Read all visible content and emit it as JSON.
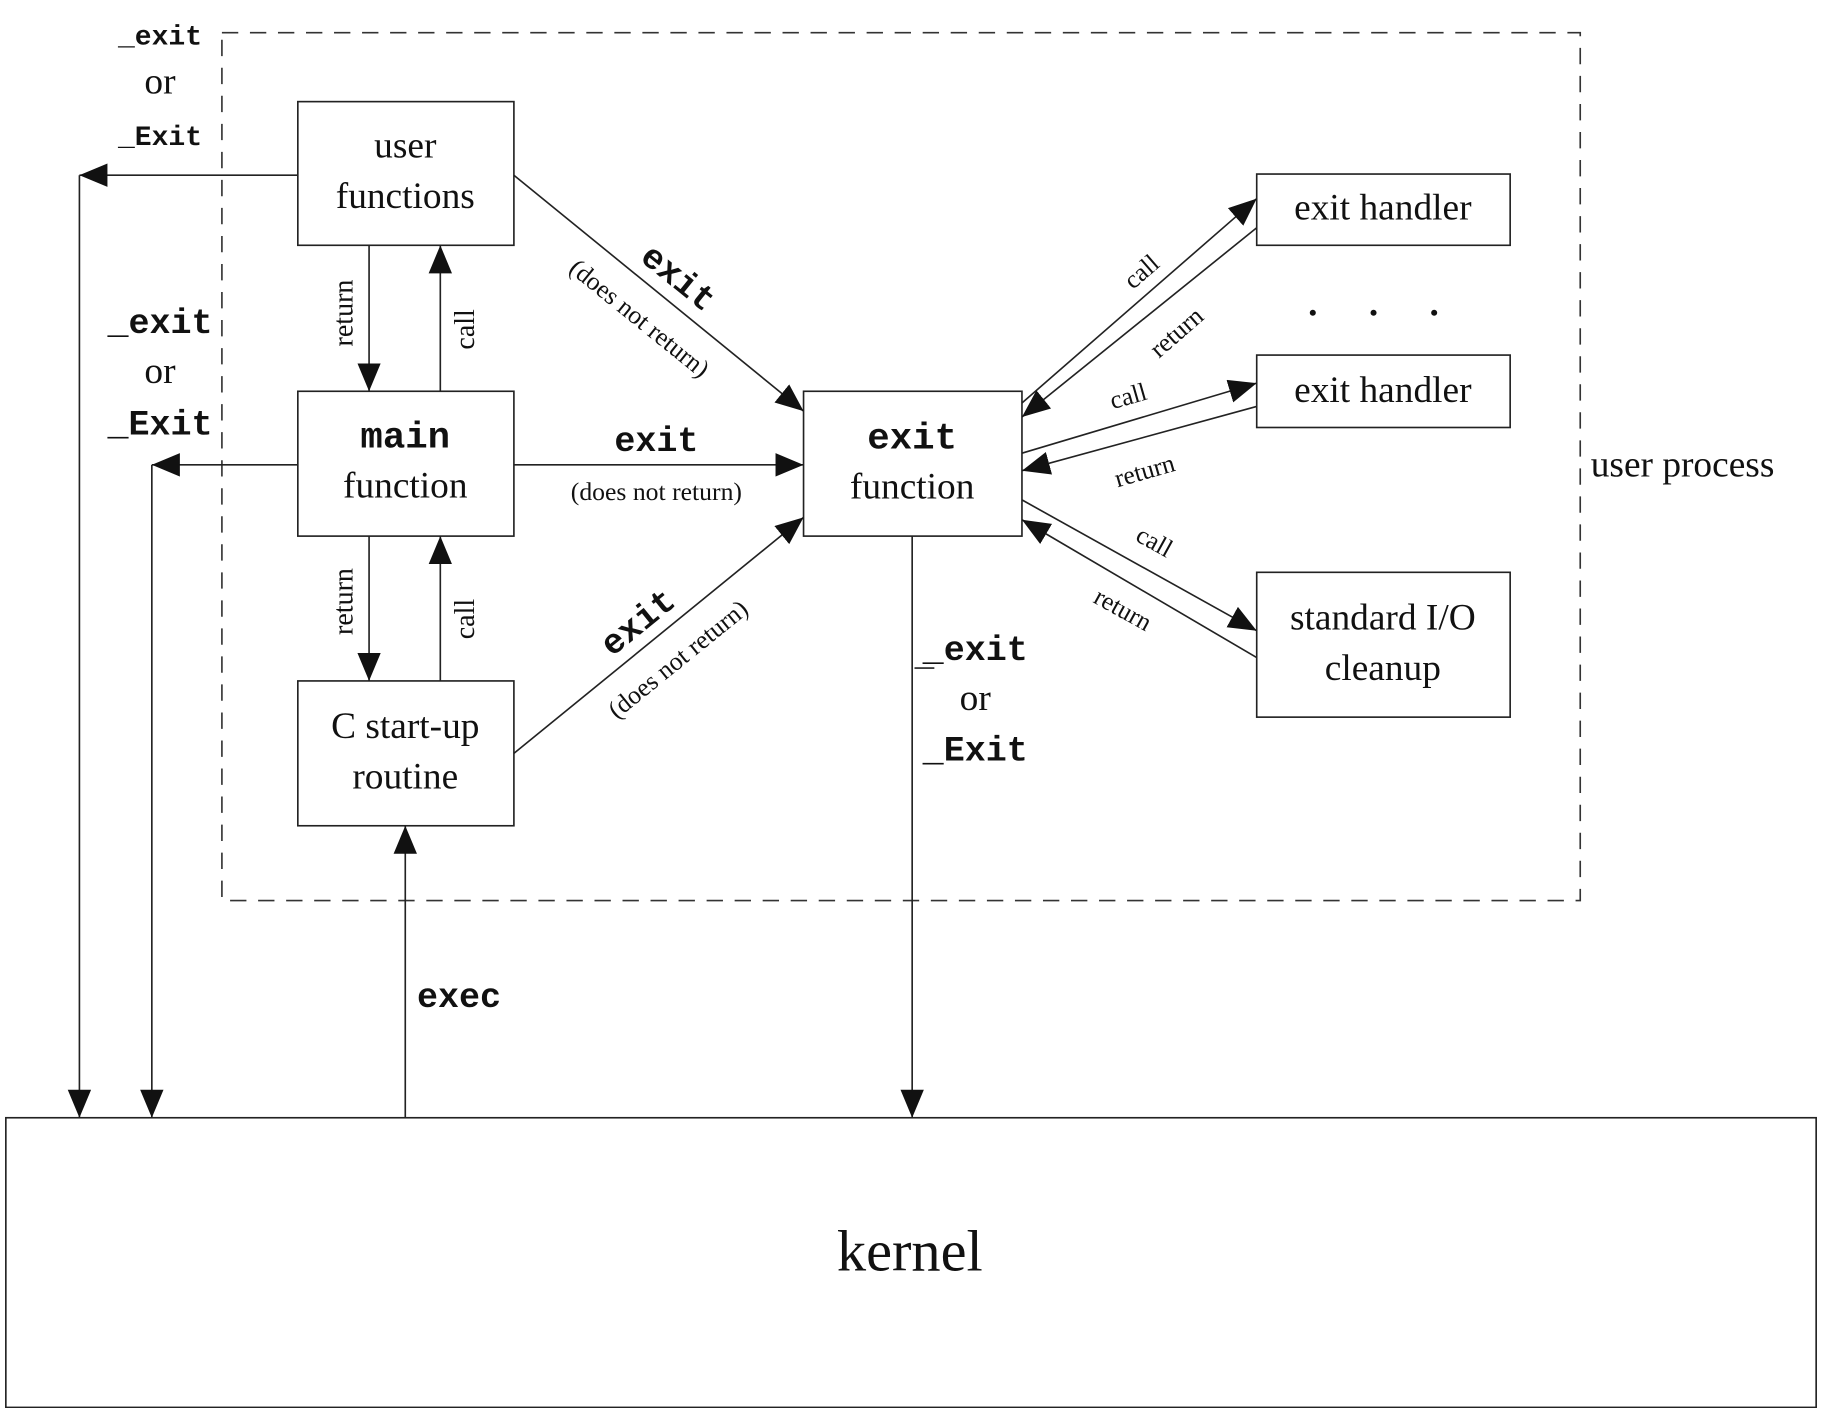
{
  "boxes": {
    "user_functions": [
      "user",
      "functions"
    ],
    "main_function": [
      "main",
      "function"
    ],
    "c_startup": [
      "C start-up",
      "routine"
    ],
    "exit_function": [
      "exit",
      "function"
    ],
    "exit_handler_1": "exit handler",
    "exit_handler_2": "exit handler",
    "stdio_cleanup": [
      "standard I/O",
      "cleanup"
    ],
    "kernel": "kernel"
  },
  "region_label": "user process",
  "ellipsis": ". . .",
  "labels": {
    "exit_or_Exit": [
      "_exit",
      "or",
      "_Exit"
    ],
    "return": "return",
    "call": "call",
    "exit": "exit",
    "does_not_return": "(does not return)",
    "exec": "exec"
  },
  "colors": {
    "line": "#222222",
    "background": "#ffffff"
  }
}
